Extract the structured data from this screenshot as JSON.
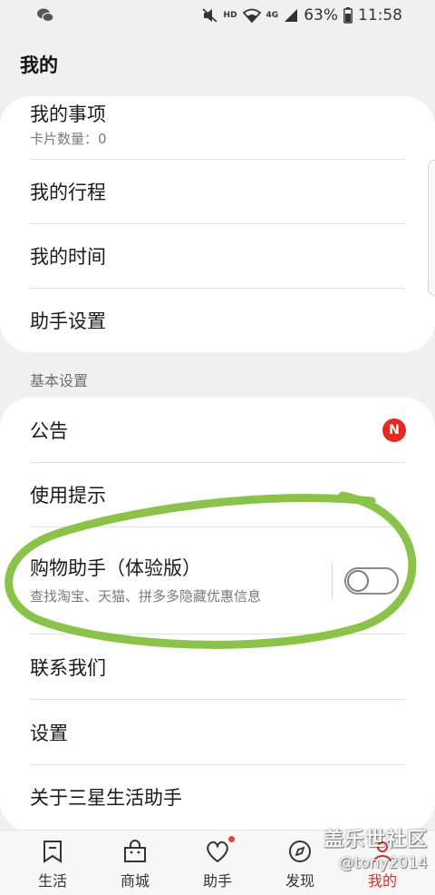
{
  "status_bar": {
    "battery": "63%",
    "time": "11:58",
    "network": "4G",
    "hd": "HD",
    "icons": [
      "wechat-icon",
      "mute-icon",
      "hd-icon",
      "wifi-icon",
      "signal-icon",
      "battery-icon"
    ]
  },
  "page": {
    "title": "我的"
  },
  "card1": {
    "items": [
      {
        "label": "我的事项",
        "sub": "卡片数量：0"
      },
      {
        "label": "我的行程"
      },
      {
        "label": "我的时间"
      },
      {
        "label": "助手设置"
      }
    ]
  },
  "section": {
    "basic_settings": "基本设置"
  },
  "card2": {
    "items": [
      {
        "label": "公告",
        "badge": "N"
      },
      {
        "label": "使用提示"
      },
      {
        "label": "购物助手（体验版）",
        "sub": "查找淘宝、天猫、拼多多隐藏优惠信息",
        "toggle": false
      },
      {
        "label": "联系我们"
      },
      {
        "label": "设置"
      },
      {
        "label": "关于三星生活助手"
      }
    ]
  },
  "bottom_nav": {
    "items": [
      {
        "label": "生活",
        "icon": "bookmark-icon"
      },
      {
        "label": "商城",
        "icon": "shopping-bag-icon"
      },
      {
        "label": "助手",
        "icon": "heart-icon"
      },
      {
        "label": "发现",
        "icon": "compass-icon"
      },
      {
        "label": "我的",
        "icon": "person-icon"
      }
    ],
    "active": "我的"
  },
  "watermark": {
    "main": "盖乐世社区",
    "sub": "@tony2014"
  },
  "colors": {
    "badge": "#e42a1f",
    "annotation": "#8bc34a",
    "active_nav": "#d32f2f"
  }
}
